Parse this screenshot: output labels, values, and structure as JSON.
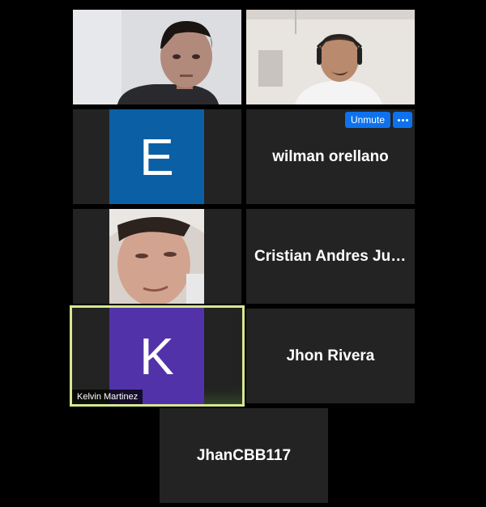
{
  "colors": {
    "background": "#000000",
    "tile": "#232323",
    "active_speaker_border": "#d6e890",
    "button_blue": "#0e72ed"
  },
  "participants": [
    {
      "kind": "video",
      "name": ""
    },
    {
      "kind": "video",
      "name": ""
    },
    {
      "kind": "avatar",
      "initial": "E",
      "avatar_color": "#0b5fa5"
    },
    {
      "kind": "name",
      "name": "wilman orellano",
      "unmute_label": "Unmute",
      "more_icon": "ellipsis-icon"
    },
    {
      "kind": "photo"
    },
    {
      "kind": "name",
      "name": "Cristian Andres Juli..."
    },
    {
      "kind": "avatar",
      "initial": "K",
      "avatar_color": "#5232a8",
      "name_tag": "Kelvin Martinez",
      "active_speaker": true
    },
    {
      "kind": "name",
      "name": "Jhon Rivera"
    },
    {
      "kind": "name",
      "name": "JhanCBB117"
    }
  ]
}
